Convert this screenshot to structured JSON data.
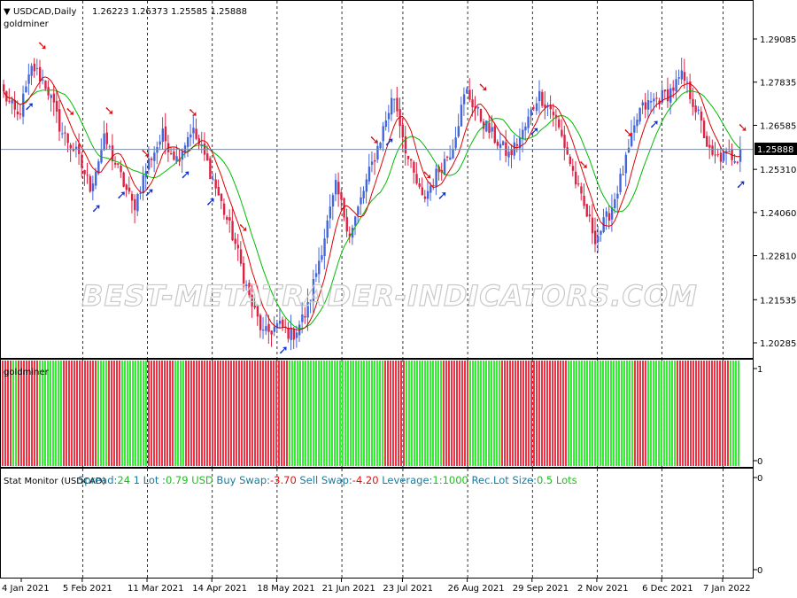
{
  "main_window": {
    "symbol_timeframe": "USDCAD,Daily",
    "ohlc": "1.26223 1.26373 1.25585 1.25888",
    "indicator_name": "goldminer",
    "current_price": "1.25888",
    "watermark": "BEST-METATRADER-INDICATORS.COM"
  },
  "subwindow_goldminer": {
    "title": "goldminer",
    "scale_top": "1",
    "scale_bottom": "0",
    "colors": {
      "buy": "#33ee33",
      "sell": "#ee3344"
    }
  },
  "subwindow_stat": {
    "title": "Stat Monitor (USDCAD)",
    "scale_top": "0",
    "scale_bottom": "0",
    "items": [
      {
        "label": "Spread:",
        "value": "24"
      },
      {
        "label": "1 Lot :",
        "value": "0.79 USD"
      },
      {
        "label": "Buy Swap:",
        "value": "-3.70"
      },
      {
        "label": "Sell Swap:",
        "value": "-4.20"
      },
      {
        "label": "Leverage:",
        "value": "1:1000"
      },
      {
        "label": "Rec.Lot Size:",
        "value": "0.5 Lots"
      }
    ]
  },
  "colors": {
    "bull": "#4466dd",
    "bear": "#dd2244",
    "ma_fast": "#dd0000",
    "ma_slow": "#00bb00",
    "arrow_up": "#1133cc",
    "arrow_down": "#dd1111"
  },
  "chart_data": {
    "type": "candlestick",
    "y_axis_ticks": [
      "1.29085",
      "1.27835",
      "1.26585",
      "1.25310",
      "1.24060",
      "1.22810",
      "1.21535",
      "1.20285"
    ],
    "ylim": [
      1.197,
      1.2985
    ],
    "x_axis_labels": [
      "4 Jan 2021",
      "5 Feb 2021",
      "11 Mar 2021",
      "14 Apr 2021",
      "18 May 2021",
      "21 Jun 2021",
      "23 Jul 2021",
      "26 Aug 2021",
      "29 Sep 2021",
      "2 Nov 2021",
      "6 Dec 2021",
      "7 Jan 2022"
    ],
    "price_path": [
      [
        1.275,
        1.273
      ],
      [
        1.268,
        1.268
      ],
      [
        1.283,
        1.286
      ],
      [
        1.277,
        1.274
      ],
      [
        1.264,
        1.264
      ],
      [
        1.258,
        1.259
      ],
      [
        1.248,
        1.247
      ],
      [
        1.262,
        1.263
      ],
      [
        1.252,
        1.254
      ],
      [
        1.242,
        1.242
      ],
      [
        1.255,
        1.258
      ],
      [
        1.263,
        1.262
      ],
      [
        1.256,
        1.256
      ],
      [
        1.265,
        1.265
      ],
      [
        1.256,
        1.253
      ],
      [
        1.244,
        1.243
      ],
      [
        1.232,
        1.228
      ],
      [
        1.216,
        1.209
      ],
      [
        1.205,
        1.205
      ],
      [
        1.208,
        1.207
      ],
      [
        1.205,
        1.203
      ],
      [
        1.212,
        1.216
      ],
      [
        1.23,
        1.238
      ],
      [
        1.248,
        1.244
      ],
      [
        1.234,
        1.239
      ],
      [
        1.248,
        1.252
      ],
      [
        1.261,
        1.266
      ],
      [
        1.275,
        1.274
      ],
      [
        1.256,
        1.249
      ],
      [
        1.244,
        1.246
      ],
      [
        1.252,
        1.25
      ],
      [
        1.259,
        1.262
      ],
      [
        1.276,
        1.283
      ],
      [
        1.268,
        1.267
      ],
      [
        1.262,
        1.26
      ],
      [
        1.257,
        1.255
      ],
      [
        1.264,
        1.267
      ],
      [
        1.275,
        1.28
      ],
      [
        1.27,
        1.267
      ],
      [
        1.258,
        1.252
      ],
      [
        1.244,
        1.237
      ],
      [
        1.233,
        1.236
      ],
      [
        1.241,
        1.244
      ],
      [
        1.254,
        1.26
      ],
      [
        1.27,
        1.278
      ],
      [
        1.273,
        1.268
      ],
      [
        1.275,
        1.285
      ],
      [
        1.28,
        1.276
      ],
      [
        1.27,
        1.263
      ],
      [
        1.256,
        1.25
      ],
      [
        1.257,
        1.262
      ],
      [
        1.257,
        1.257
      ]
    ],
    "arrows_up_dates": [
      "8 Jan 2021",
      "12 Feb 2021",
      "25 Feb 2021",
      "11 Mar 2021",
      "30 Mar 2021",
      "12 Apr 2021",
      "21 May 2021",
      "16 Jul 2021",
      "12 Aug 2021",
      "30 Sep 2021",
      "1 Dec 2021",
      "18 Jan 2022"
    ],
    "arrows_down_dates": [
      "14 Jan 2021",
      "28 Jan 2021",
      "17 Feb 2021",
      "9 Mar 2021",
      "2 Apr 2021",
      "28 Apr 2021",
      "6 Jul 2021",
      "3 Aug 2021",
      "1 Sep 2021",
      "25 Oct 2021",
      "17 Nov 2021",
      "19 Jan 2022"
    ],
    "histogram_segments": [
      [
        "sell",
        0
      ],
      [
        "buy",
        12
      ],
      [
        "sell",
        18
      ],
      [
        "buy",
        40
      ],
      [
        "sell",
        68
      ],
      [
        "buy",
        107
      ],
      [
        "sell",
        120
      ],
      [
        "buy",
        133
      ],
      [
        "sell",
        165
      ],
      [
        "buy",
        193
      ],
      [
        "sell",
        205
      ],
      [
        "buy",
        322
      ],
      [
        "sell",
        430
      ],
      [
        "buy",
        455
      ],
      [
        "sell",
        498
      ],
      [
        "buy",
        528
      ],
      [
        "sell",
        562
      ],
      [
        "buy",
        637
      ],
      [
        "sell",
        713
      ],
      [
        "buy",
        727
      ],
      [
        "sell",
        760
      ],
      [
        "buy",
        820
      ],
      [
        "sell",
        833
      ]
    ]
  }
}
